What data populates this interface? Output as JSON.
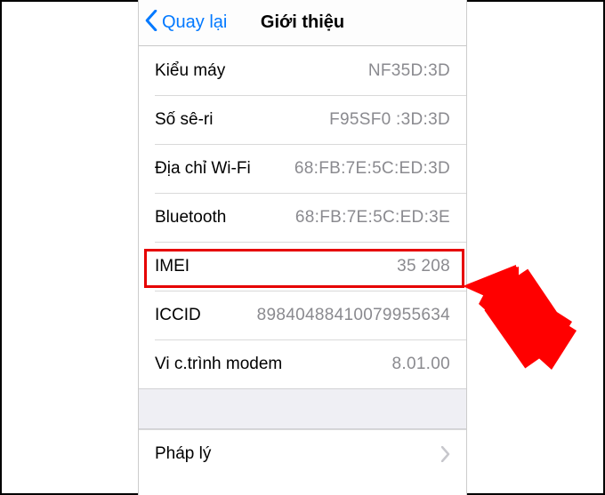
{
  "nav": {
    "back_label": "Quay lại",
    "title": "Giới thiệu"
  },
  "rows": {
    "model": {
      "label": "Kiểu máy",
      "value": "NF35D:3D"
    },
    "serial": {
      "label": "Số sê-ri",
      "value": "F95SF0 :3D:3D"
    },
    "wifi": {
      "label": "Địa chỉ Wi-Fi",
      "value": "68:FB:7E:5C:ED:3D"
    },
    "bluetooth": {
      "label": "Bluetooth",
      "value": "68:FB:7E:5C:ED:3E"
    },
    "imei": {
      "label": "IMEI",
      "value": "35 208"
    },
    "iccid": {
      "label": "ICCID",
      "value": "89840488410079955634"
    },
    "modem": {
      "label": "Vi c.trình modem",
      "value": "8.01.00"
    },
    "legal": {
      "label": "Pháp lý"
    }
  },
  "colors": {
    "accent": "#0279ff",
    "highlight": "#e60000"
  }
}
